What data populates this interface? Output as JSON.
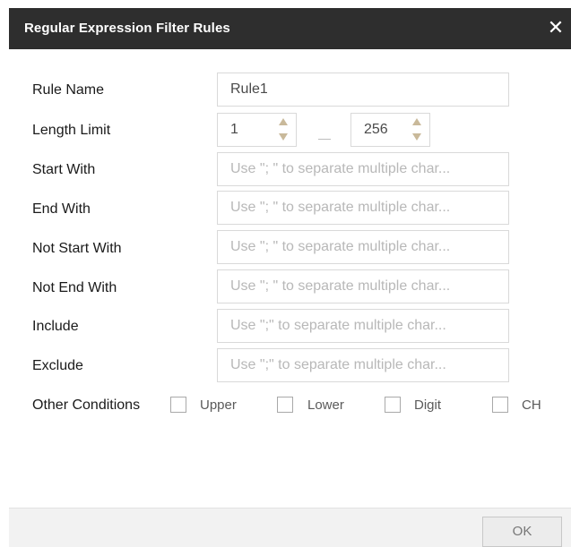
{
  "dialog": {
    "title": "Regular Expression Filter Rules",
    "close_glyph": "✕"
  },
  "fields": {
    "rule_name": {
      "label": "Rule Name",
      "value": "Rule1"
    },
    "length_limit": {
      "label": "Length Limit",
      "min": "1",
      "max": "256"
    },
    "start_with": {
      "label": "Start With",
      "placeholder": "Use \"; \" to separate multiple char..."
    },
    "end_with": {
      "label": "End With",
      "placeholder": "Use \"; \" to separate multiple char..."
    },
    "not_start_with": {
      "label": "Not Start With",
      "placeholder": "Use \"; \" to separate multiple char..."
    },
    "not_end_with": {
      "label": "Not End With",
      "placeholder": "Use \"; \" to separate multiple char..."
    },
    "include": {
      "label": "Include",
      "placeholder": "Use \";\" to separate multiple char..."
    },
    "exclude": {
      "label": "Exclude",
      "placeholder": "Use \";\" to separate multiple char..."
    }
  },
  "other_conditions": {
    "label": "Other Conditions",
    "options": [
      {
        "label": "Upper",
        "checked": false
      },
      {
        "label": "Lower",
        "checked": false
      },
      {
        "label": "Digit",
        "checked": false
      },
      {
        "label": "CH",
        "checked": false
      }
    ]
  },
  "footer": {
    "ok_label": "OK"
  },
  "colors": {
    "titlebar_bg": "#2e2e2e",
    "spinner_arrow": "#c9b99a",
    "border": "#d9d9d9"
  },
  "icons": {
    "close": "close-icon",
    "spinner_up": "arrow-up-icon",
    "spinner_down": "arrow-down-icon"
  }
}
